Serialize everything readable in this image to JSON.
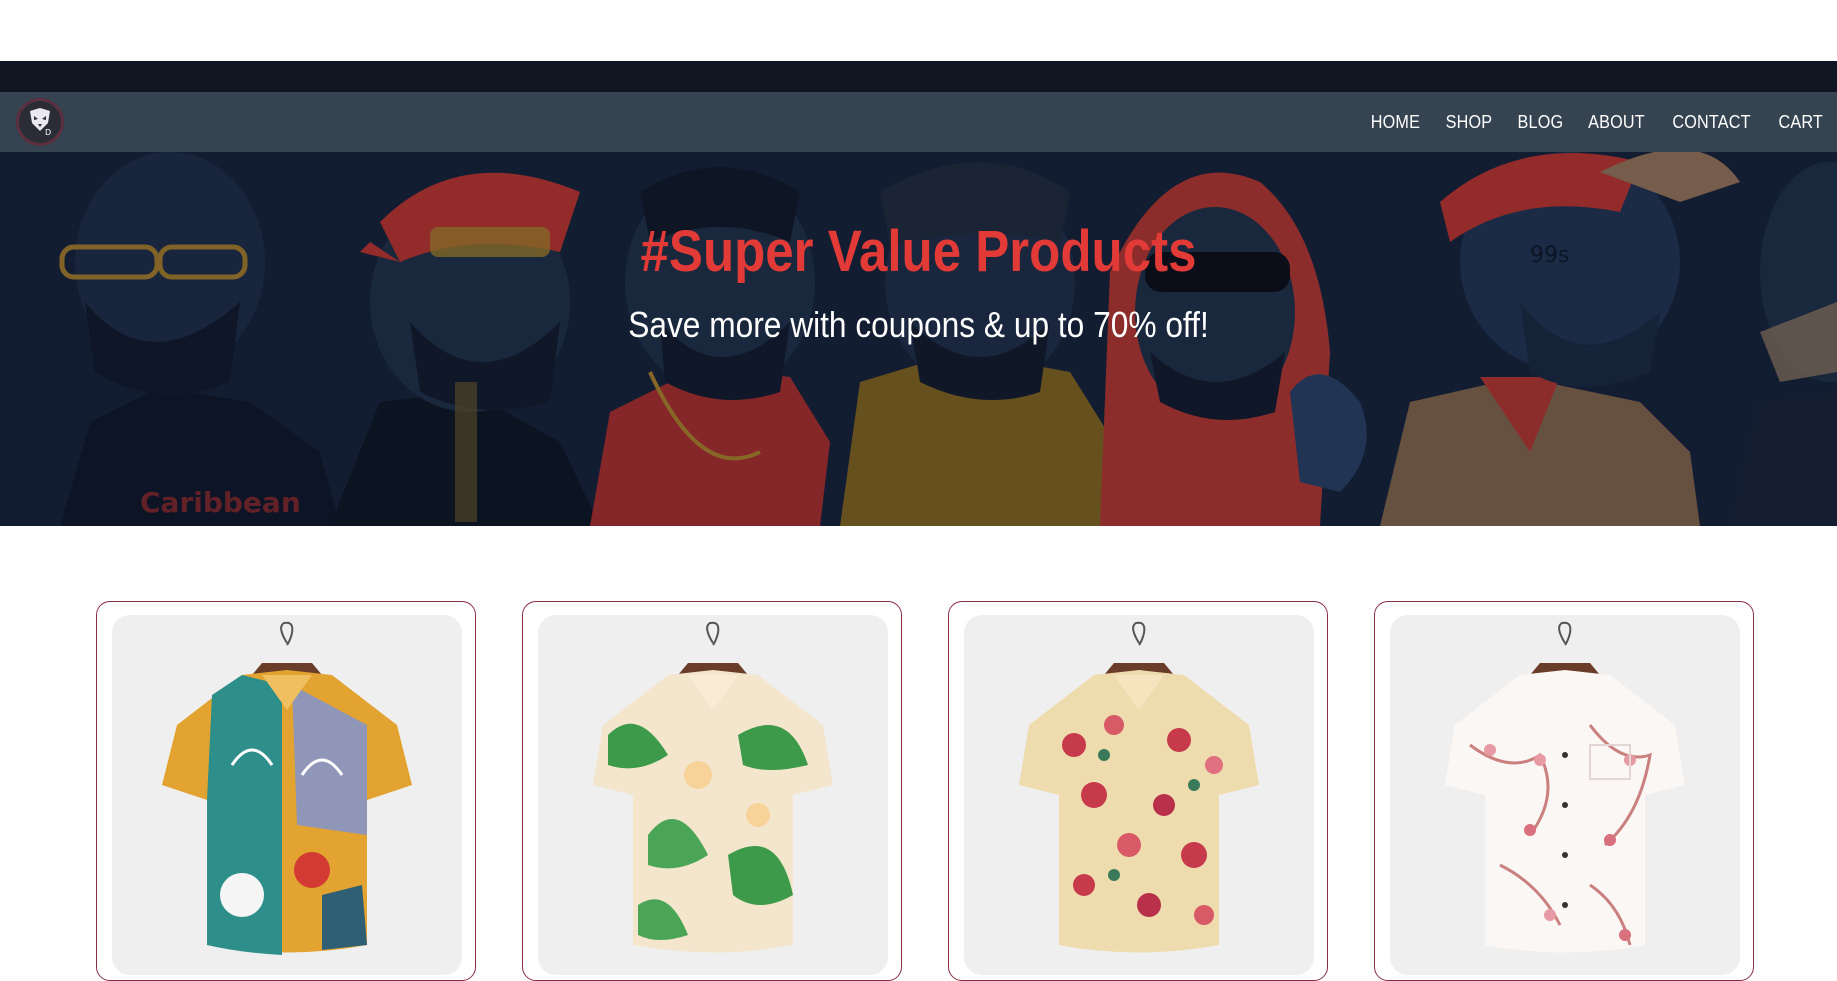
{
  "nav": {
    "logo_alt": "logo",
    "links": [
      "HOME",
      "SHOP",
      "BLOG",
      "ABOUT",
      "CONTACT",
      "CART"
    ]
  },
  "hero": {
    "title": "#Super Value Products",
    "subtitle": "Save more with coupons & up to 70% off!"
  },
  "products": [
    {
      "pattern": "abstract-multicolor-shirt"
    },
    {
      "pattern": "green-leaf-floral-shirt"
    },
    {
      "pattern": "red-floral-cream-shirt"
    },
    {
      "pattern": "pink-blossom-white-shirt"
    }
  ],
  "colors": {
    "navbar": "#364452",
    "hero_title": "#e23a37",
    "card_border": "#8a2f43"
  }
}
